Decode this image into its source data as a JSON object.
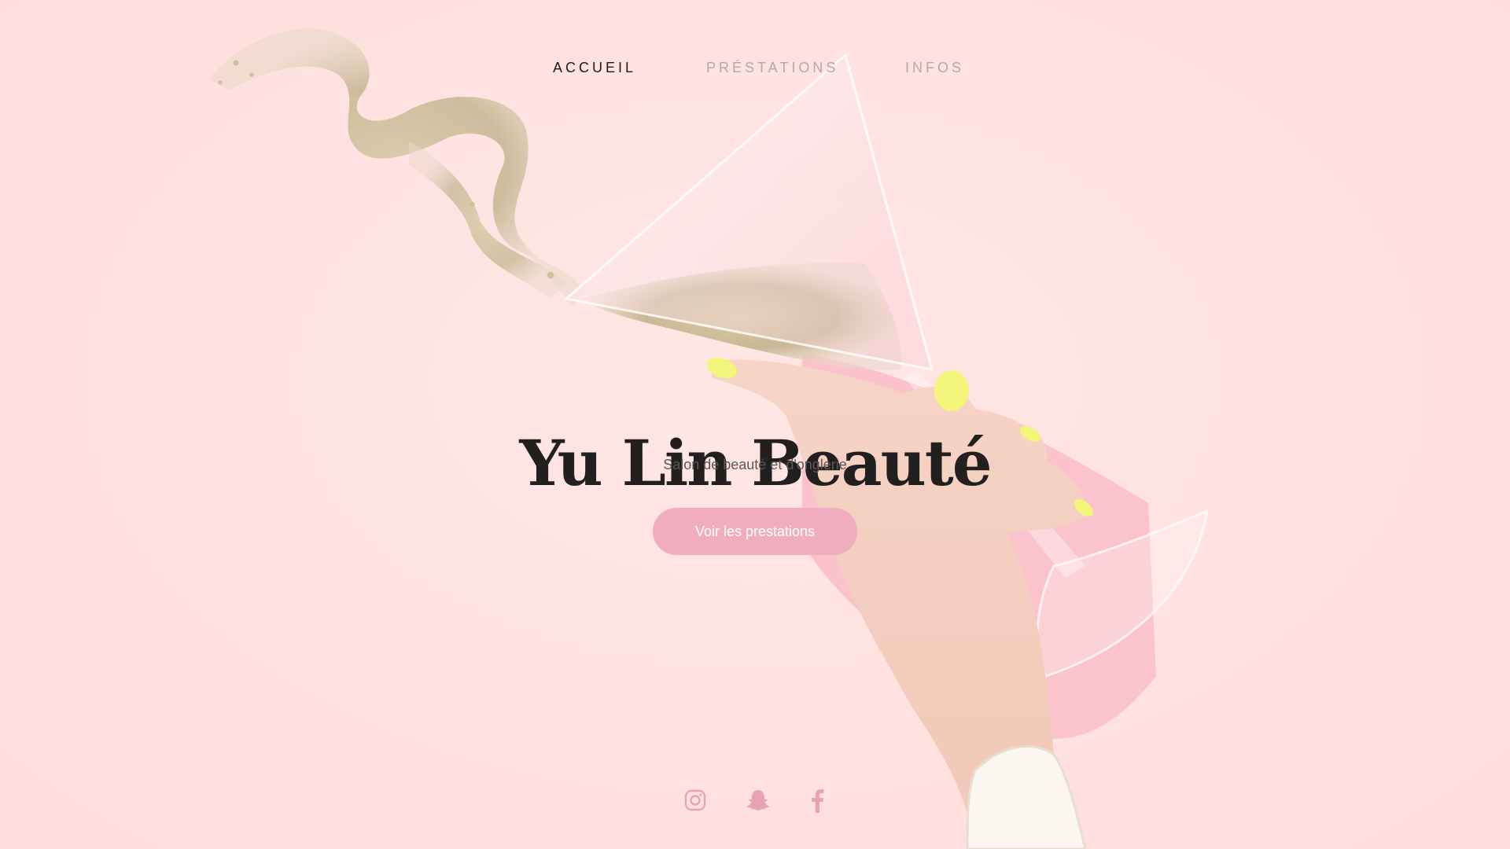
{
  "nav": {
    "items": [
      {
        "label": "ACCUEIL",
        "active": true
      },
      {
        "label": "PRÉSTATIONS",
        "active": false
      },
      {
        "label": "INFOS",
        "active": false
      }
    ]
  },
  "hero": {
    "title": "Yu Lin Beauté",
    "subtitle": "Salon de beauté et d'onglerie",
    "cta_label": "Voir les prestations"
  },
  "social": {
    "icons": [
      "instagram-icon",
      "snapchat-icon",
      "facebook-icon"
    ]
  },
  "colors": {
    "background": "#ffe4e3",
    "accent": "#f0adbf",
    "nav_active": "#1b1b1b",
    "nav_inactive": "#b7a7a8",
    "title": "#221f1f",
    "social_icon": "#e6a3b4"
  }
}
